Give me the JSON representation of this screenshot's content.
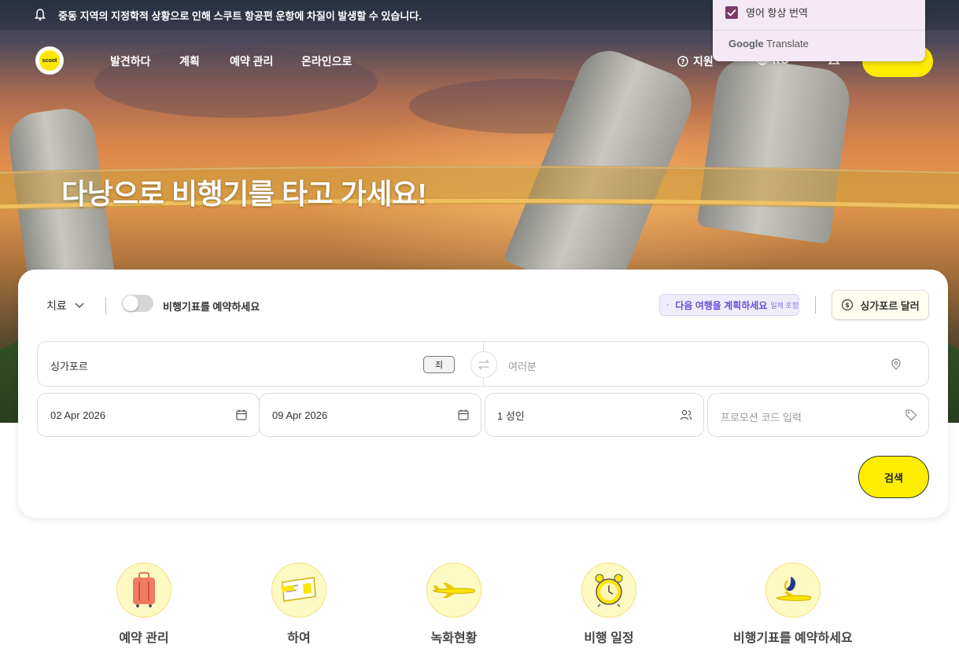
{
  "notice": {
    "text": "중동 지역의 지정학적 상황으로 인해 스쿠트 항공편 운항에 차질이 발생할 수 있습니다."
  },
  "logo": {
    "text": "scoot"
  },
  "nav": {
    "items": [
      "발견하다",
      "계획",
      "예약 관리",
      "온라인으로"
    ],
    "support": "지원",
    "language": "KO"
  },
  "translate_popup": {
    "option": "영어 항상 번역",
    "brand_google": "Google",
    "brand_translate": "Translate"
  },
  "hero": {
    "title": "다낭으로 비행기를 타고 가세요!"
  },
  "booking": {
    "trip_type": "치료",
    "toggle_label": "비행기표를 예약하세요",
    "ai_plan": "다음 여행을 계획하세요",
    "ai_plan_extra": "일체 포함",
    "currency": "싱가포르 달러",
    "origin": "싱가포르",
    "origin_badge": "죄",
    "destination_placeholder": "여러분",
    "depart_date": "02 Apr 2026",
    "return_date": "09 Apr 2026",
    "passengers": "1 성인",
    "promo_placeholder": "프로모션 코드 입력",
    "search": "검색"
  },
  "quick_links": [
    "예약 관리",
    "하여",
    "녹화현황",
    "비행 일정",
    "비행기표를 예약하세요"
  ],
  "colors": {
    "brand_yellow": "#ffee00",
    "accent_purple": "#6b4fd8",
    "popup_check": "#7a3a6a"
  }
}
